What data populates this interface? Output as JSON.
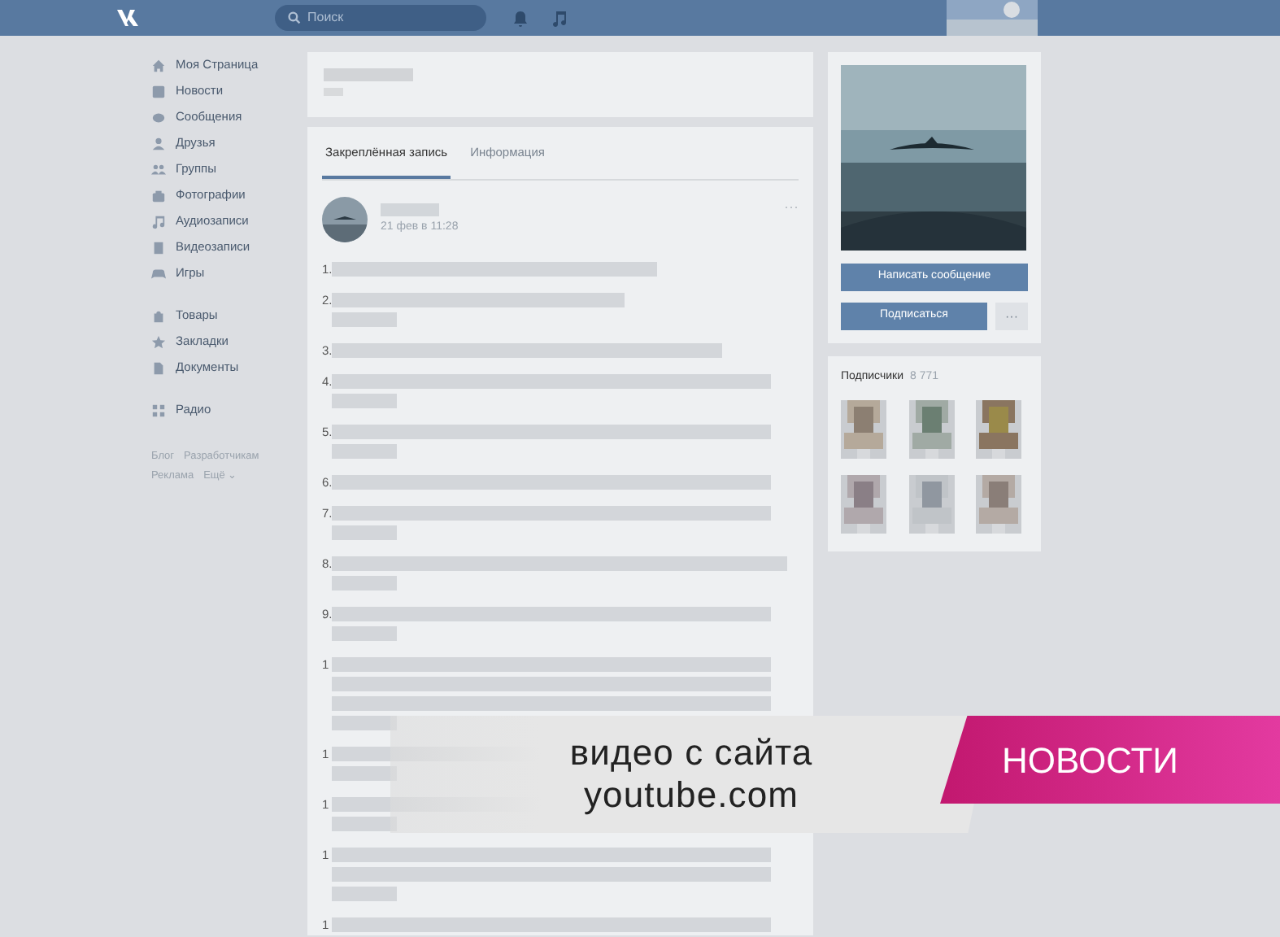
{
  "topbar": {
    "search": {
      "placeholder": "Поиск"
    }
  },
  "sidebar": {
    "items": [
      "Моя Страница",
      "Новости",
      "Сообщения",
      "Друзья",
      "Группы",
      "Фотографии",
      "Аудиозаписи",
      "Видеозаписи",
      "Игры",
      "Товары",
      "Закладки",
      "Документы",
      "Радио"
    ],
    "footer_links": [
      "Блог",
      "Разработчикам",
      "Реклама",
      "Ещё ⌄"
    ]
  },
  "tabs": [
    {
      "label": "Закреплённая запись",
      "selected": true
    },
    {
      "label": "Информация",
      "selected": false
    }
  ],
  "post": {
    "date": "21 фев в 11:28",
    "more": "···",
    "paragraph_numbers": [
      "1.",
      "2.",
      "3.",
      "4.",
      "5.",
      "6.",
      "7.",
      "8.",
      "9.",
      "1",
      "1",
      "1",
      "1",
      "1"
    ]
  },
  "profile": {
    "buttons": [
      "Написать сообщение",
      "Подписаться"
    ],
    "more": "···"
  },
  "followers": {
    "title": "Подписчики",
    "count": "8 771"
  },
  "overlay": {
    "caption": [
      "видео с сайта",
      "youtube.com"
    ],
    "tag": "НОВОСТИ"
  }
}
